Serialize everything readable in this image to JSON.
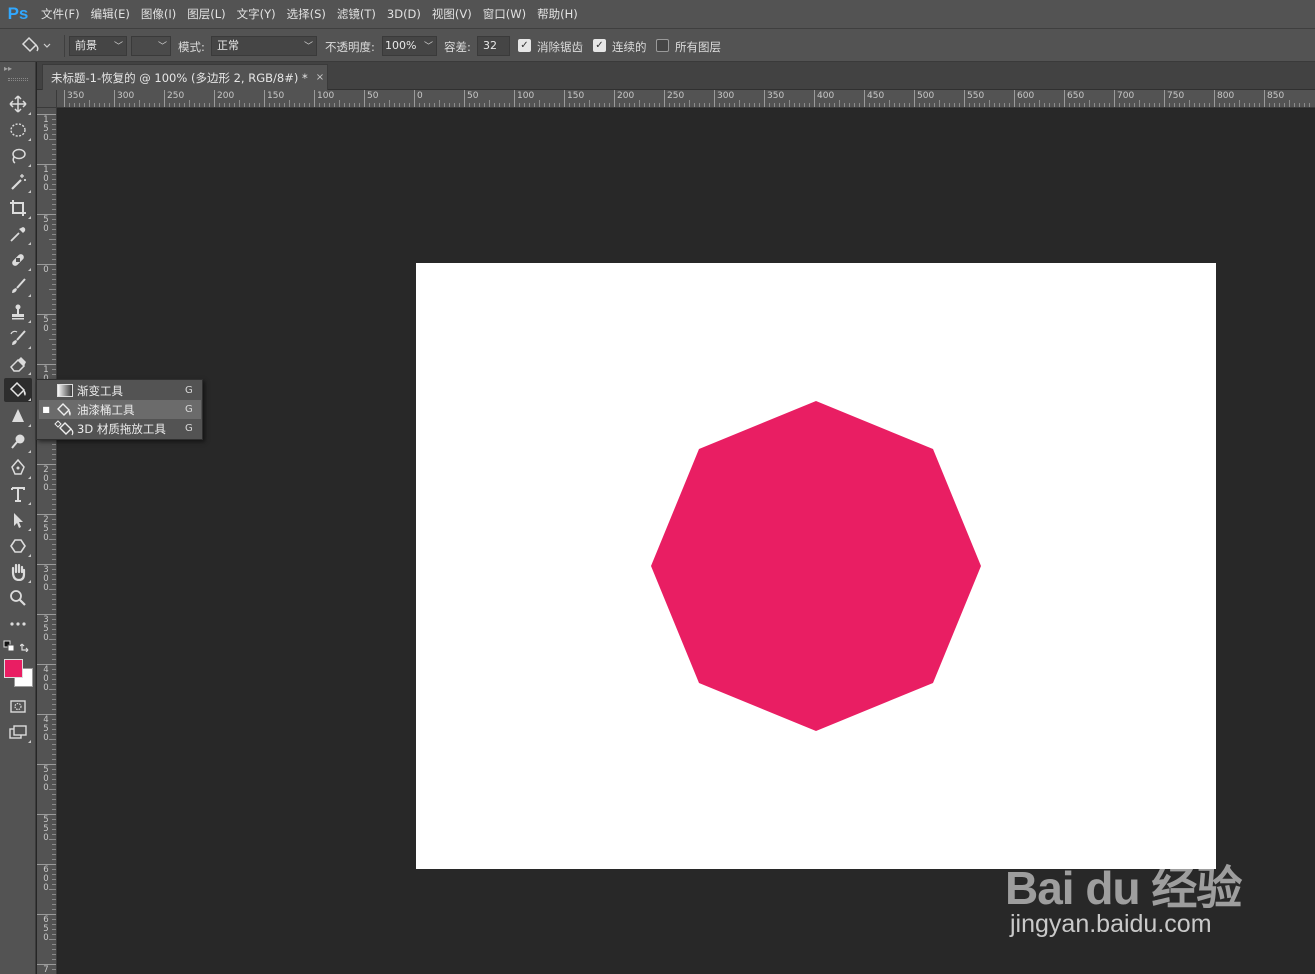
{
  "app": {
    "logo": "Ps"
  },
  "menu": [
    "文件(F)",
    "编辑(E)",
    "图像(I)",
    "图层(L)",
    "文字(Y)",
    "选择(S)",
    "滤镜(T)",
    "3D(D)",
    "视图(V)",
    "窗口(W)",
    "帮助(H)"
  ],
  "options": {
    "fill_source": "前景",
    "mode_label": "模式:",
    "mode_value": "正常",
    "opacity_label": "不透明度:",
    "opacity_value": "100%",
    "tolerance_label": "容差:",
    "tolerance_value": "32",
    "antialias_label": "消除锯齿",
    "antialias_checked": true,
    "contiguous_label": "连续的",
    "contiguous_checked": true,
    "all_layers_label": "所有图层",
    "all_layers_checked": false
  },
  "document": {
    "tab_title": "未标题-1-恢复的 @ 100% (多边形 2, RGB/8#) *",
    "close_glyph": "×",
    "shape_color": "#e91e63",
    "background_color": "#ffffff"
  },
  "ruler": {
    "top_labels": [
      "350",
      "300",
      "250",
      "200",
      "150",
      "100",
      "50",
      "0",
      "50",
      "100",
      "150",
      "200",
      "250",
      "300",
      "350",
      "400",
      "450",
      "500",
      "550",
      "600",
      "650",
      "700",
      "750",
      "800",
      "850"
    ],
    "left_labels": [
      "150",
      "100",
      "50",
      "0",
      "50",
      "100",
      "150",
      "200",
      "250",
      "300",
      "350",
      "400",
      "450",
      "500",
      "550",
      "600",
      "650",
      "7"
    ]
  },
  "colors": {
    "foreground": "#e91e63",
    "background": "#ffffff",
    "accent": "#31a8ff"
  },
  "tools": [
    "move-icon",
    "marquee-icon",
    "lasso-icon",
    "magic-wand-icon",
    "crop-icon",
    "eyedropper-icon",
    "healing-icon",
    "brush-icon",
    "stamp-icon",
    "history-brush-icon",
    "eraser-icon",
    "paint-bucket-icon",
    "blur-icon",
    "dodge-icon",
    "pen-icon",
    "type-icon",
    "path-select-icon",
    "shape-icon",
    "hand-icon",
    "zoom-icon",
    "more-icon"
  ],
  "flyout": [
    {
      "label": "渐变工具",
      "key": "G",
      "icon": "gradient-icon",
      "selected": false
    },
    {
      "label": "油漆桶工具",
      "key": "G",
      "icon": "paint-bucket-icon",
      "selected": true
    },
    {
      "label": "3D 材质拖放工具",
      "key": "G",
      "icon": "3d-material-drop-icon",
      "selected": false
    }
  ],
  "watermark": {
    "logo": "Bai du 经验",
    "url": "jingyan.baidu.com"
  }
}
